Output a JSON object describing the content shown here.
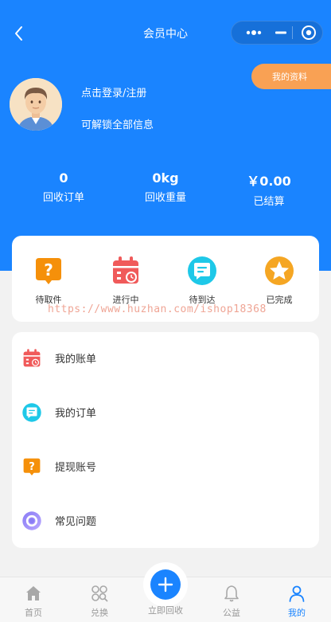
{
  "navbar": {
    "title": "会员中心",
    "back_icon": "chevron-left-icon",
    "capsule": {
      "more_icon": "more-dots-icon",
      "minimize_icon": "minus-icon",
      "close_icon": "target-circle-icon"
    }
  },
  "header": {
    "profile_button": "我的资料",
    "login_text": "点击登录/注册",
    "unlock_text": "可解锁全部信息",
    "avatar_icon": "user-avatar-icon",
    "stats": [
      {
        "value": "0",
        "label": "回收订单"
      },
      {
        "value": "0kg",
        "label": "回收重量"
      },
      {
        "value": "￥0.00",
        "label": "已结算"
      }
    ]
  },
  "order_status": [
    {
      "label": "待取件",
      "icon": "question-bubble-icon",
      "color": "#f5900a"
    },
    {
      "label": "进行中",
      "icon": "calendar-clock-icon",
      "color": "#f05a5a"
    },
    {
      "label": "待到达",
      "icon": "message-bubble-icon",
      "color": "#1ec8e8"
    },
    {
      "label": "已完成",
      "icon": "star-icon",
      "color": "#f5a623"
    }
  ],
  "watermark": "https://www.huzhan.com/ishop18368",
  "menu": [
    {
      "label": "我的账单",
      "icon": "calendar-clock-icon"
    },
    {
      "label": "我的订单",
      "icon": "message-bubble-icon"
    },
    {
      "label": "提现账号",
      "icon": "question-bubble-icon"
    },
    {
      "label": "常见问题",
      "icon": "help-ring-icon"
    }
  ],
  "tabbar": [
    {
      "label": "首页",
      "icon": "home-icon",
      "active": false
    },
    {
      "label": "兑换",
      "icon": "exchange-icon",
      "active": false
    },
    {
      "label": "立即回收",
      "icon": "plus-icon",
      "active": false
    },
    {
      "label": "公益",
      "icon": "bell-icon",
      "active": false
    },
    {
      "label": "我的",
      "icon": "user-icon",
      "active": true
    }
  ],
  "colors": {
    "brand_blue": "#1a84ff",
    "orange": "#f9a154",
    "page_bg": "#f2f2f2"
  }
}
